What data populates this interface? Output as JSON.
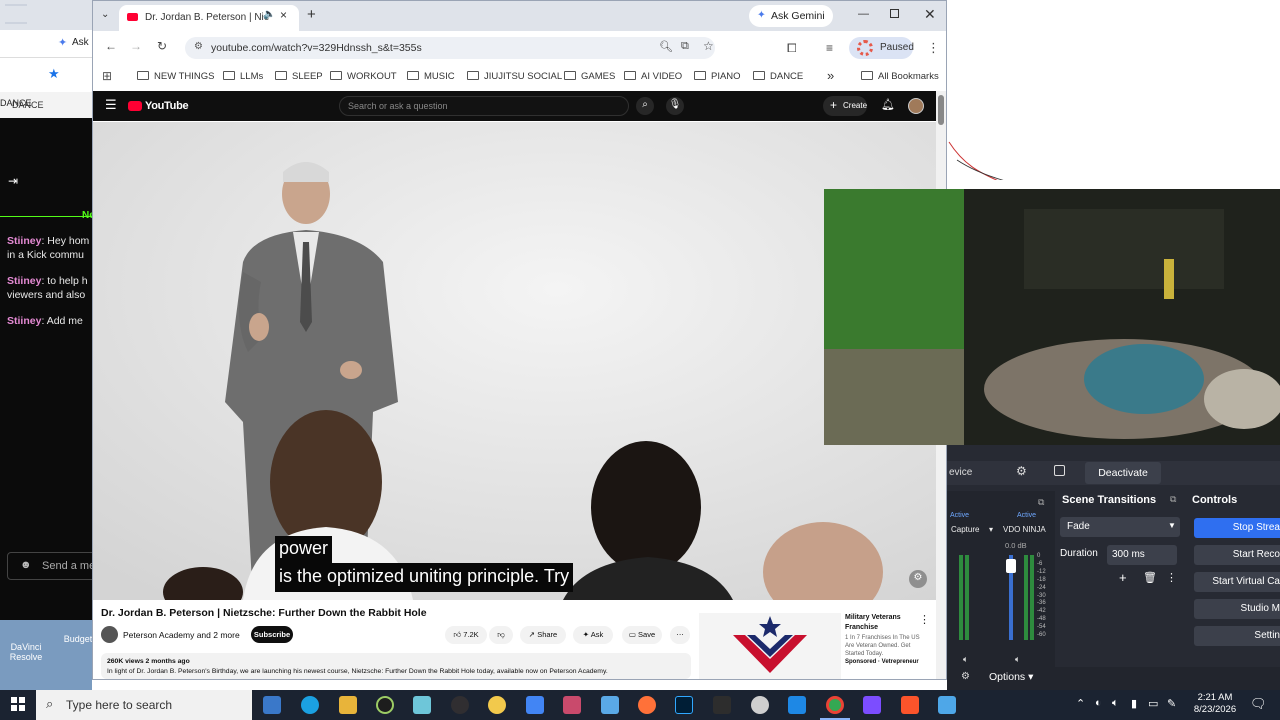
{
  "background_left": {
    "tab_label": "Ask",
    "bookmark": "DANCE",
    "chat": {
      "new_label": "Ne",
      "messages": [
        {
          "user": "Stiiney",
          "text": "Hey hom",
          "cont": "in a Kick commu"
        },
        {
          "user": "Stiiney",
          "text": "to help h",
          "cont": "viewers and also"
        },
        {
          "user": "Stiiney",
          "text": "Add me",
          "cont": ""
        }
      ],
      "send_placeholder": "Send a me"
    },
    "desktop_icons": [
      "DaVinci Resolve",
      "Budget"
    ]
  },
  "browser": {
    "tab_title": "Dr. Jordan B. Peterson | Nie",
    "ask_gemini": "Ask Gemini",
    "url": "youtube.com/watch?v=329Hdnssh_s&t=355s",
    "paused_label": "Paused",
    "bookmarks": [
      "NEW THINGS",
      "LLMs",
      "SLEEP",
      "WORKOUT",
      "MUSIC",
      "JIUJITSU SOCIAL",
      "GAMES",
      "AI VIDEO",
      "PIANO",
      "DANCE"
    ],
    "all_bookmarks": "All Bookmarks",
    "more_glyph": "»"
  },
  "youtube": {
    "logo_text": "YouTube",
    "search_placeholder": "Search or ask a question",
    "create_label": "Create",
    "captions": [
      "power",
      "is the optimized uniting principle. Try"
    ],
    "title": "Dr. Jordan B. Peterson | Nietzsche: Further Down the Rabbit Hole",
    "channel": "Peterson Academy and 2 more",
    "subscribe": "Subscribe",
    "likes": "7.2K",
    "share": "Share",
    "ask": "Ask",
    "save": "Save",
    "views_line": "260K views  2 months ago",
    "description": "In light of Dr. Jordan B. Peterson's Birthday, we are launching his newest course, Nietzsche: Further Down the Rabbit Hole today, available now on Peterson Academy.",
    "ad": {
      "title": "Military Veterans Franchise",
      "body": "1 In 7 Franchises In The US Are Veteran Owned. Get Started Today.",
      "sponsor": "Sponsored · Vetrepreneur"
    }
  },
  "obs": {
    "device_label": "evice",
    "deactivate": "Deactivate",
    "scene_transitions": "Scene Transitions",
    "controls": "Controls",
    "mixer": {
      "active1": "Active",
      "active2": "Active",
      "source1": "Capture",
      "source2": "VDO NINJA",
      "db": "0.0 dB",
      "scale": [
        "0",
        "-6",
        "-12",
        "-18",
        "-24",
        "-30",
        "-36",
        "-42",
        "-48",
        "-54",
        "-60"
      ]
    },
    "transition": "Fade",
    "duration_label": "Duration",
    "duration_value": "300 ms",
    "options": "Options",
    "buttons": [
      "Stop Strea",
      "Start Reco",
      "Start Virtual Ca",
      "Studio M",
      "Settin"
    ]
  },
  "taskbar": {
    "search_placeholder": "Type here to search",
    "time": "2:21 AM",
    "date": "8/23/2026"
  }
}
